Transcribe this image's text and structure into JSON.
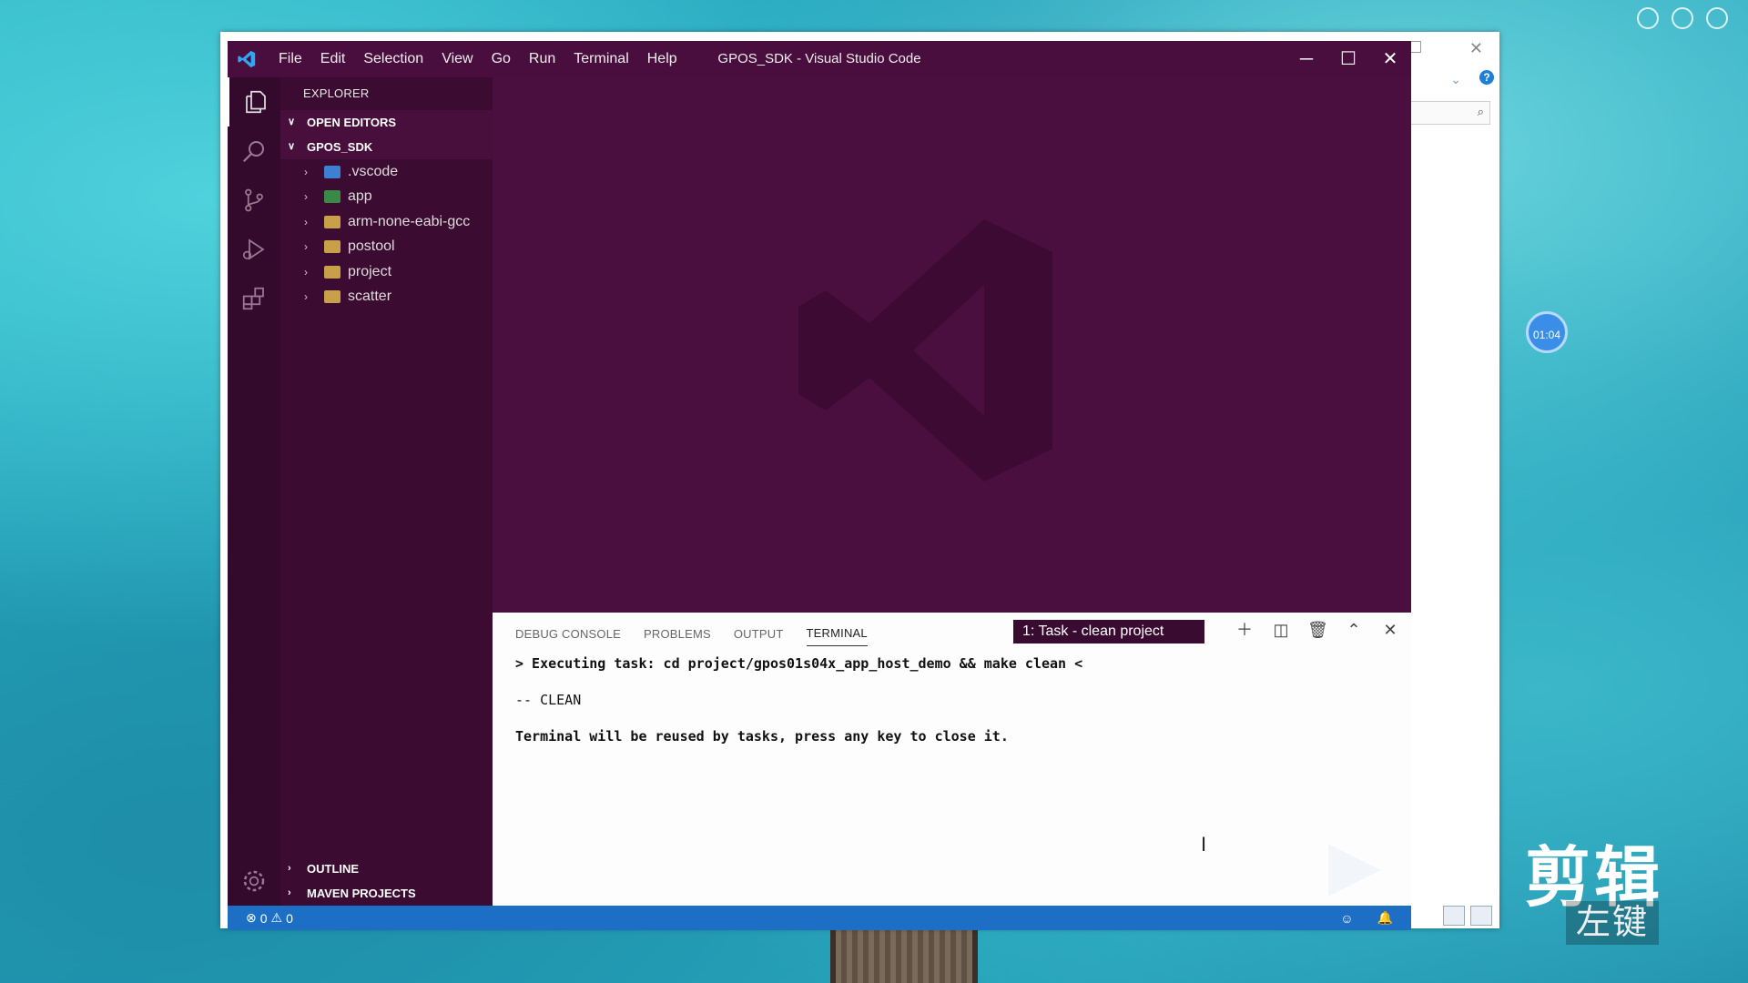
{
  "window": {
    "title": "GPOS_SDK - Visual Studio Code"
  },
  "menu": [
    "File",
    "Edit",
    "Selection",
    "View",
    "Go",
    "Run",
    "Terminal",
    "Help"
  ],
  "window_controls": {
    "minimize": "─",
    "maximize": "☐",
    "close": "✕"
  },
  "explorer": {
    "title": "EXPLORER",
    "open_editors": "OPEN EDITORS",
    "root": "GPOS_SDK",
    "items": [
      ".vscode",
      "app",
      "arm-none-eabi-gcc",
      "postool",
      "project",
      "scatter"
    ],
    "outline": "OUTLINE",
    "maven": "MAVEN PROJECTS"
  },
  "panel": {
    "tabs": [
      "DEBUG CONSOLE",
      "PROBLEMS",
      "OUTPUT",
      "TERMINAL"
    ],
    "active_tab": "TERMINAL",
    "terminal_select": "1: Task - clean project",
    "lines": [
      "> Executing task: cd project/gpos01s04x_app_host_demo && make clean <",
      "-- CLEAN",
      "Terminal will be reused by tasks, press any key to close it."
    ]
  },
  "status": {
    "errors": "0",
    "warnings": "0"
  },
  "overlay": {
    "timer": "01:04",
    "brand": "剪辑",
    "brand_sub": "左键"
  },
  "colors": {
    "titlebar": "#4a0e3e",
    "sidebar": "#3b0b32",
    "activity": "#330a2c",
    "statusbar": "#1d6fc5",
    "editor": "#4b0f3f"
  }
}
